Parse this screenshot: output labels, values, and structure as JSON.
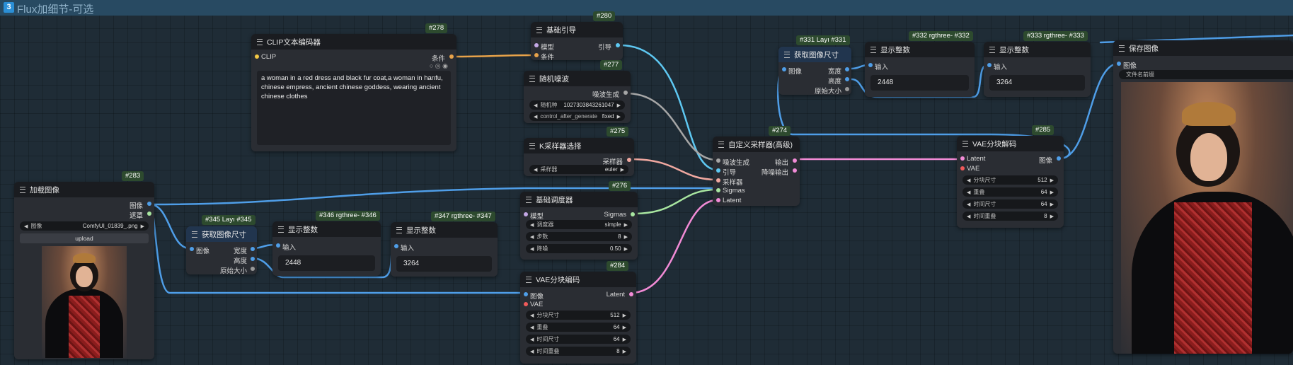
{
  "group": {
    "index": "3",
    "title": "Flux加细节-可选"
  },
  "colors": {
    "link_cyan": "#5ec8f2",
    "link_blue": "#4f9ee8",
    "link_orange": "#e8a34a",
    "link_pink": "#f28bd6",
    "link_salmon": "#f0a8a0",
    "link_green": "#a8e6a0",
    "link_gray": "#a6a6a6"
  },
  "nodes": {
    "clip": {
      "badge": "#278",
      "title": "CLIP文本编码器",
      "in_clip": "CLIP",
      "out_cond": "条件",
      "text": "a woman in a red dress and black fur coat,a woman in hanfu, chinese empress,  ancient chinese goddess, wearing ancient chinese clothes"
    },
    "guide": {
      "badge": "#280",
      "title": "基础引导",
      "in_model": "模型",
      "in_cond": "条件",
      "out_guide": "引导"
    },
    "noise": {
      "badge": "#277",
      "title": "随机噪波",
      "out": "噪波生成",
      "w_seed_label": "随机种",
      "w_seed_value": "1027303843261047",
      "w_ctrl_label": "control_after_generate",
      "w_ctrl_value": "fixed"
    },
    "ksel": {
      "badge": "#275",
      "title": "K采样器选择",
      "out": "采样器",
      "w_label": "采样器",
      "w_value": "euler"
    },
    "sched": {
      "badge": "#276",
      "title": "基础调度器",
      "in_model": "模型",
      "out": "Sigmas",
      "widgets": [
        {
          "label": "调度器",
          "value": "simple"
        },
        {
          "label": "步数",
          "value": "8"
        },
        {
          "label": "降噪",
          "value": "0.50"
        }
      ]
    },
    "vaeenc": {
      "badge": "#284",
      "title": "VAE分块编码",
      "in_image": "图像",
      "in_vae": "VAE",
      "out": "Latent",
      "widgets": [
        {
          "label": "分块尺寸",
          "value": "512"
        },
        {
          "label": "重叠",
          "value": "64"
        },
        {
          "label": "时间尺寸",
          "value": "64"
        },
        {
          "label": "时间重叠",
          "value": "8"
        }
      ]
    },
    "custom": {
      "badge": "#274",
      "title": "自定义采样器(高级)",
      "ins": [
        "噪波生成",
        "引导",
        "采样器",
        "Sigmas",
        "Latent"
      ],
      "outs": [
        "输出",
        "降噪输出"
      ]
    },
    "load": {
      "badge": "#283",
      "title": "加载图像",
      "out_image": "图像",
      "out_mask": "遮罩",
      "w_label": "图像",
      "w_value": "ComfyUI_01839_.png",
      "upload": "upload"
    },
    "size345": {
      "badge": "#345 Layı #345",
      "title": "获取图像尺寸",
      "in": "图像",
      "outs": [
        "宽度",
        "高度",
        "原始大小"
      ]
    },
    "int346": {
      "badge": "#346 rgthree- #346",
      "title": "显示整数",
      "in": "输入",
      "value": "2448"
    },
    "int347": {
      "badge": "#347 rgthree- #347",
      "title": "显示整数",
      "in": "输入",
      "value": "3264"
    },
    "size331": {
      "badge": "#331 Layı #331",
      "title": "获取图像尺寸",
      "in": "图像",
      "outs": [
        "宽度",
        "高度",
        "原始大小"
      ]
    },
    "int332": {
      "badge": "#332 rgthree- #332",
      "title": "显示整数",
      "in": "输入",
      "value": "2448"
    },
    "int333": {
      "badge": "#333 rgthree- #333",
      "title": "显示整数",
      "in": "输入",
      "value": "3264"
    },
    "vaedec": {
      "badge": "#285",
      "title": "VAE分块解码",
      "in_latent": "Latent",
      "in_vae": "VAE",
      "out": "图像",
      "widgets": [
        {
          "label": "分块尺寸",
          "value": "512"
        },
        {
          "label": "重叠",
          "value": "64"
        },
        {
          "label": "时间尺寸",
          "value": "64"
        },
        {
          "label": "时间重叠",
          "value": "8"
        }
      ]
    },
    "save": {
      "title": "保存图像",
      "in_image": "图像",
      "w_prefix": "文件名前缀"
    }
  }
}
